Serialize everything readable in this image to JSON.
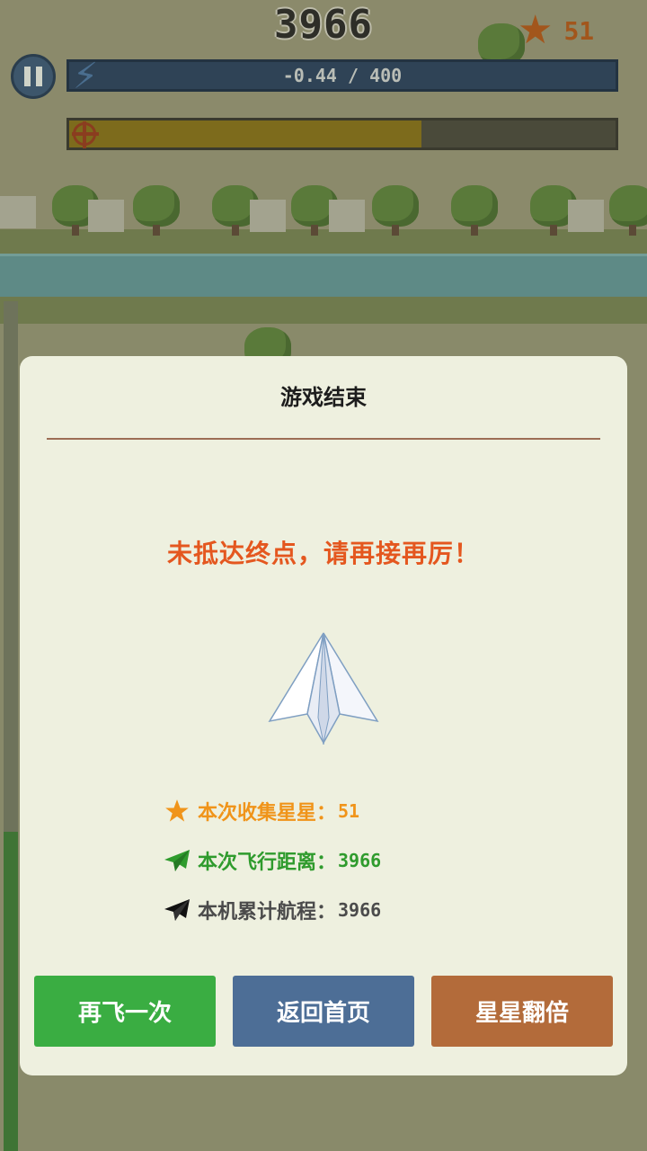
{
  "hud": {
    "score": "3966",
    "stars": "51",
    "energy_text": "-0.44 / 400",
    "progress_fraction": 0.645
  },
  "dialog": {
    "title": "游戏结束",
    "message": "未抵达终点，请再接再厉！",
    "stats": [
      {
        "label": "本次收集星星：",
        "value": "51",
        "icon": "star-icon",
        "color": "#f0941a"
      },
      {
        "label": "本次飞行距离：",
        "value": "3966",
        "icon": "paper-plane-icon",
        "color": "#2f9b2d"
      },
      {
        "label": "本机累计航程：",
        "value": "3966",
        "icon": "paper-plane-icon",
        "color": "#4b4b4b"
      }
    ],
    "buttons": {
      "retry": "再飞一次",
      "home": "返回首页",
      "double": "星星翻倍"
    }
  },
  "colors": {
    "dialog_bg": "#eef0df",
    "message": "#e4571f",
    "retry": "#3aad42",
    "home": "#4d6e96",
    "double": "#b36b3a"
  }
}
